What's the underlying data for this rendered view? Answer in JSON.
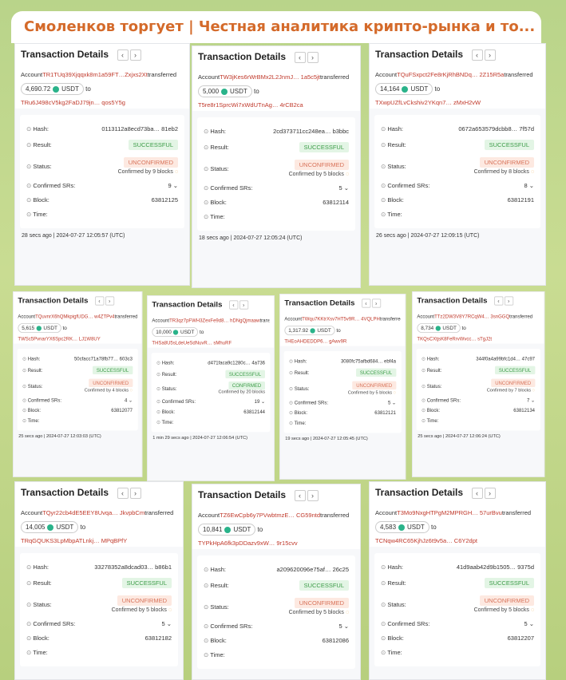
{
  "channel_title": "Смоленков торгует | Честная аналитика крипто-рынка и то...",
  "labels": {
    "details": "Transaction Details",
    "prev": "‹",
    "next": "›",
    "account": "Account",
    "transferred": "transferred",
    "to": "to",
    "token": "USDT",
    "hash": "Hash:",
    "result": "Result:",
    "status": "Status:",
    "confirmed_srs": "Confirmed SRs:",
    "block": "Block:",
    "time": "Time:"
  },
  "cards": [
    {
      "from": "TR1TUq39Xjqqxk8m1a59FT…Zxjxs2Xt",
      "amount": "4,690.72",
      "to": "TRu6J498cV5kg2FaDJ79jn… qos5Y5g",
      "hash": "0113112a8ecd73ba… 81eb2",
      "result": "SUCCESSFUL",
      "status": "UNCONFIRMED",
      "confirmed": "Confirmed by 9 blocks",
      "srs": "9",
      "block": "63812125",
      "ago": "28 secs ago",
      "ts": "2024-07-27 12:05:57 (UTC)"
    },
    {
      "from": "TW3jKes6rWrBMx2L2JnmJ… 1a5c5jt",
      "amount": "5,000",
      "to": "T5re8r1SprcWi7xWdUTnAg… 4rCB2ca",
      "hash": "2cd373711cc248ea… b3bbc",
      "result": "SUCCESSFUL",
      "status": "UNCONFIRMED",
      "confirmed": "Confirmed by 5 blocks",
      "srs": "5",
      "block": "63812114",
      "ago": "18 secs ago",
      "ts": "2024-07-27 12:05:24 (UTC)"
    },
    {
      "from": "TQuFSxpct2Fe8rKjRhBNDq… 2Z15R5a",
      "amount": "14,164",
      "to": "TXwpUZfLvCkshiv2YKqn7… zMxH2vW",
      "hash": "0672a653579dcbb8… 7f57d",
      "result": "SUCCESSFUL",
      "status": "UNCONFIRMED",
      "confirmed": "Confirmed by 8 blocks",
      "srs": "8",
      "block": "63812191",
      "ago": "26 secs ago",
      "ts": "2024-07-27 12:09:15 (UTC)"
    },
    {
      "from": "TQuvnrX6hQMkpigfUDG… w4ZTPv4",
      "amount": "5,615",
      "to": "TWSc5PvnarYX6Spc2RK… LJ1W8UY",
      "hash": "50cfacc71a78fb77… 603c3",
      "result": "SUCCESSFUL",
      "status": "UNCONFIRMED",
      "confirmed": "Confirmed by 4 blocks",
      "srs": "4",
      "block": "63812077",
      "ago": "25 secs ago",
      "ts": "2024-07-27 12:03:03 (UTC)"
    },
    {
      "from": "TR3qz7pFWH3ZexFe9d8… hDNgQjmaaw",
      "amount": "10,000",
      "to": "THSa8U5sLdeUeSdNuvR… sMhuRF",
      "hash": "d471faca9c1280c… 4a736",
      "result": "SUCCESSFUL",
      "status": "CONFIRMED",
      "confirmed": "Confirmed by 20 blocks",
      "srs": "19",
      "block": "63812144",
      "ago": "1 min 29 secs ago",
      "ts": "2024-07-27 12:06:54 (UTC)"
    },
    {
      "from": "TWqu7KKtrXsv7HT5v9R… 4VQLPH",
      "amount": "1,317.92",
      "to": "THEoAHDEDDP6… gAwv9R",
      "hash": "3080fc75afbd684… ebf4a",
      "result": "SUCCESSFUL",
      "status": "UNCONFIRMED",
      "confirmed": "Confirmed by 5 blocks",
      "srs": "5",
      "block": "63812121",
      "ago": "19 secs ago",
      "ts": "2024-07-27 12:05:45 (UTC)"
    },
    {
      "from": "TTz2DW3V8Y7RCqW4… 3snGGQ",
      "amount": "8,734",
      "to": "TKQsCXtjsK8FeRrvWvcc… sTgJ2t",
      "hash": "344f0a4a99bfc1d4… 47c97",
      "result": "SUCCESSFUL",
      "status": "UNCONFIRMED",
      "confirmed": "Confirmed by 7 blocks",
      "srs": "7",
      "block": "63812134",
      "ago": "25 secs ago",
      "ts": "2024-07-27 12:06:24 (UTC)"
    },
    {
      "from": "TQyr22cb4dE5EEY8Uvqa… JkvpbCm",
      "amount": "14,005",
      "to": "TRqGQUKS3LpMbpATLnkj… MPqBPfY",
      "hash": "33278352a8dcad03… b86b1",
      "result": "SUCCESSFUL",
      "status": "UNCONFIRMED",
      "confirmed": "Confirmed by 5 blocks",
      "srs": "5",
      "block": "63812182",
      "ago": "",
      "ts": ""
    },
    {
      "from": "TZ6EwCpb6y7PVwbtmzE… CG59ntd",
      "amount": "10,841",
      "to": "TYPkHpA6fk3pDDazv9xW… 9r15cvv",
      "hash": "a209620096e75af… 26c25",
      "result": "SUCCESSFUL",
      "status": "UNCONFIRMED",
      "confirmed": "Confirmed by 5 blocks",
      "srs": "5",
      "block": "63812086",
      "ago": "",
      "ts": ""
    },
    {
      "from": "T3Mo9NxgHTPgM2MPRGH… 57urBvu",
      "amount": "4,583",
      "to": "TCNqw4RC65KjhJz6t9v5a… C6Y2dpt",
      "hash": "41d9aab42d9b1505… 9375d",
      "result": "SUCCESSFUL",
      "status": "UNCONFIRMED",
      "confirmed": "Confirmed by 5 blocks",
      "srs": "5",
      "block": "63812207",
      "ago": "",
      "ts": ""
    }
  ],
  "colors": {
    "accent": "#d46a2a",
    "success": "#3b9b47",
    "warning": "#d8735a",
    "background": "#b9d48a"
  }
}
